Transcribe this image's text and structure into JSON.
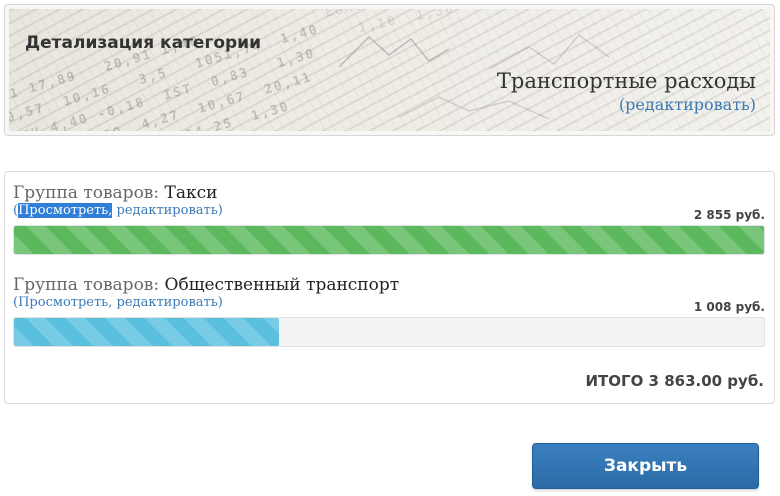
{
  "header": {
    "subtitle": "Детализация категории",
    "category_title": "Транспортные расходы",
    "edit_label": "(редактировать)"
  },
  "groups": [
    {
      "prefix": "Группа товаров: ",
      "name": "Такси",
      "link_open": "(",
      "view_label": "Просмотреть,",
      "edit_label": "редактировать",
      "link_close": ")",
      "amount": "2 855 руб.",
      "fill_fraction": 1.0,
      "color": "#5cb85c"
    },
    {
      "prefix": "Группа товаров: ",
      "name": "Общественный транспорт",
      "link_open": "(",
      "view_label": "Просмотреть,",
      "edit_label": "редактировать",
      "link_close": ")",
      "amount": "1 008 руб.",
      "fill_fraction": 0.353,
      "color": "#5bc0de"
    }
  ],
  "total_label": "ИТОГО 3 863.00 руб.",
  "close_label": "Закрыть",
  "colors": {
    "accent": "#2f7ed8",
    "link": "#3a7ab5",
    "button": "#3173b1"
  }
}
